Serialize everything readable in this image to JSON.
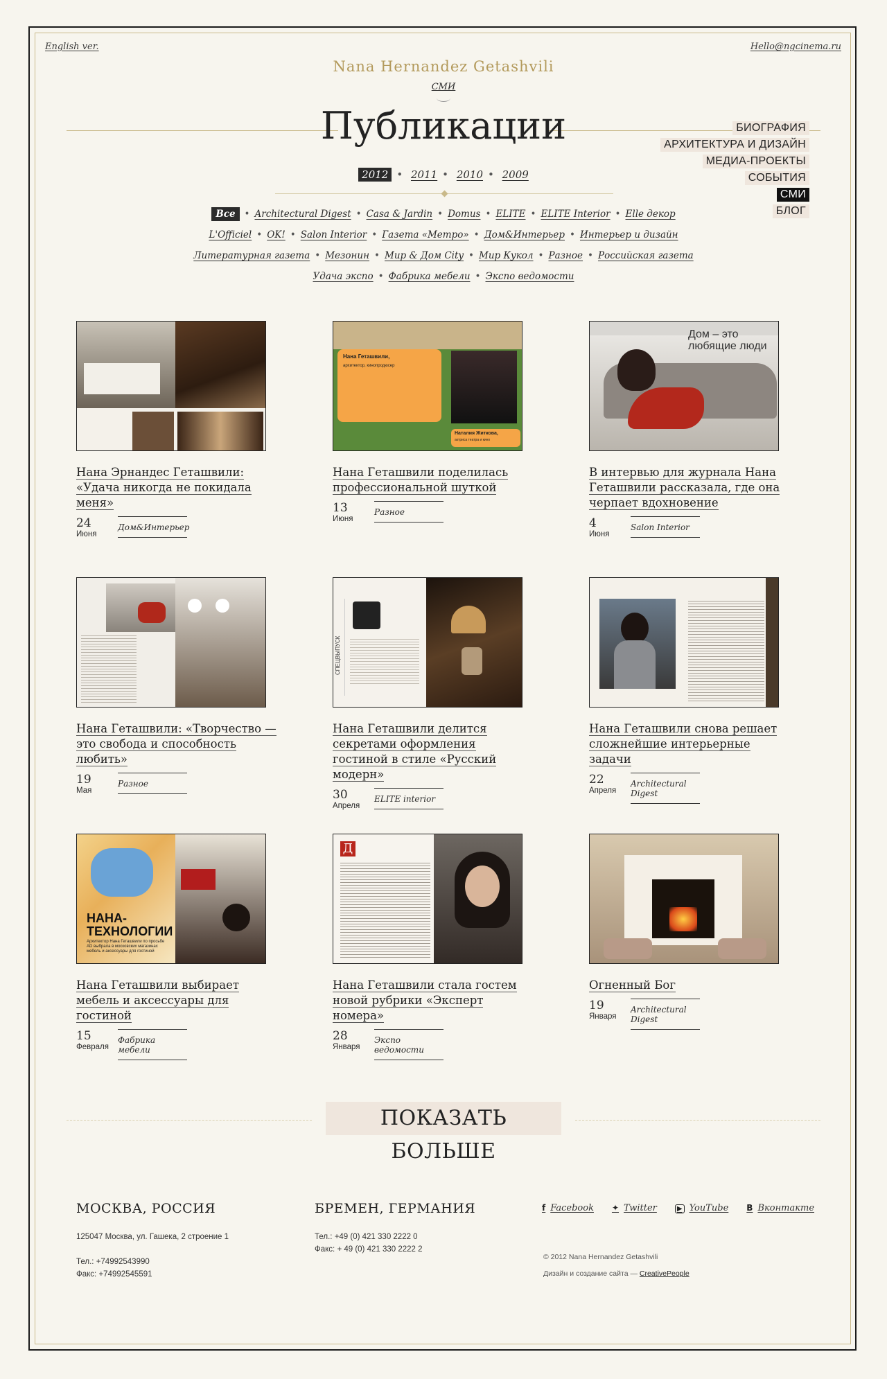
{
  "header": {
    "lang_link": "English ver.",
    "email": "Hello@ngcinema.ru",
    "site_name": "Nana Hernandez Getashvili",
    "section": "СМИ",
    "title": "Публикации"
  },
  "nav": {
    "items": [
      {
        "label": "БИОГРАФИЯ",
        "active": false
      },
      {
        "label": "АРХИТЕКТУРА И ДИЗАЙН",
        "active": false
      },
      {
        "label": "МЕДИА-ПРОЕКТЫ",
        "active": false
      },
      {
        "label": "СОБЫТИЯ",
        "active": false
      },
      {
        "label": "СМИ",
        "active": true
      },
      {
        "label": "БЛОГ",
        "active": false
      }
    ]
  },
  "years": [
    "2012",
    "2011",
    "2010",
    "2009"
  ],
  "years_active": "2012",
  "tags": {
    "row1": [
      "Все",
      "Architectural Digest",
      "Casa & Jardin",
      "Domus",
      "ELITE",
      "ELITE Interior",
      "Elle декор"
    ],
    "row2": [
      "L'Officiel",
      "OK!",
      "Salon Interior",
      "Газета «Метро»",
      "Дом&Интерьер",
      "Интерьер и дизайн"
    ],
    "row3": [
      "Литературная газета",
      "Мезонин",
      "Мир & Дом City",
      "Мир Кукол",
      "Разное",
      "Российская газета"
    ],
    "row4": [
      "Удача экспо",
      "Фабрика мебели",
      "Экспо ведомости"
    ]
  },
  "cards": [
    {
      "title": "Нана Эрнандес Геташвили: «Удача никогда не покидала меня»",
      "day": "24",
      "month": "Июня",
      "source": "Дом&Интерьер"
    },
    {
      "title": "Нана Геташвили поделилась профессиональной шуткой",
      "day": "13",
      "month": "Июня",
      "source": "Разное"
    },
    {
      "title": "В интервью для журнала Нана Геташвили рассказала, где она черпает вдохновение",
      "day": "4",
      "month": "Июня",
      "source": "Salon Interior"
    },
    {
      "title": "Нана Геташвили: «Творчество — это свобода и способность любить»",
      "day": "19",
      "month": "Мая",
      "source": "Разное"
    },
    {
      "title": "Нана Геташвили делится секретами оформления гостиной в стиле «Русский модерн»",
      "day": "30",
      "month": "Апреля",
      "source": "ELITE interior"
    },
    {
      "title": "Нана Геташвили снова решает сложнейшие интерьерные задачи",
      "day": "22",
      "month": "Апреля",
      "source": "Architectural Digest"
    },
    {
      "title": "Нана Геташвили выбирает мебель и аксессуары для гостиной",
      "day": "15",
      "month": "Февраля",
      "source": "Фабрика мебели"
    },
    {
      "title": "Нана Геташвили стала гостем новой рубрики «Эксперт номера»",
      "day": "28",
      "month": "Января",
      "source": "Экспо ведомости"
    },
    {
      "title": "Огненный Бог",
      "day": "19",
      "month": "Января",
      "source": "Architectural Digest"
    }
  ],
  "thumb_texts": {
    "t2_name": "Нана Геташвили,",
    "t2_role": "архитектор, кинопродюсер",
    "t2_person": "Наталия Житкова,",
    "t2_person_role": "актриса театра и кино",
    "t3_headline": "Дом – это любящие люди",
    "t7_headline": "НАНА-ТЕХНОЛОГИИ",
    "t7_sub": "Архитектор Нана Геташвили по просьбе AD выбрала в московских магазинах мебель и аксессуары для гостиной",
    "t5_spine": "СПЕЦВЫПУСК"
  },
  "more_button": "ПОКАЗАТЬ БОЛЬШЕ",
  "footer": {
    "moscow": {
      "city": "МОСКВА, РОССИЯ",
      "address": "125047 Москва, ул. Гашека, 2 строение 1",
      "phone": "Тел.: +74992543990",
      "fax": "Факс: +74992545591"
    },
    "bremen": {
      "city": "БРЕМЕН, ГЕРМАНИЯ",
      "phone": "Тел.: +49 (0) 421 330 2222 0",
      "fax": "Факс: + 49 (0) 421 330 2222 2"
    },
    "social": [
      {
        "icon": "f",
        "label": "Facebook"
      },
      {
        "icon": "🐦",
        "label": "Twitter"
      },
      {
        "icon": "▶",
        "label": "YouTube"
      },
      {
        "icon": "B",
        "label": "Вконтакте"
      }
    ],
    "copyright": "© 2012 Nana Hernandez Getashvili",
    "credit_prefix": "Дизайн и создание сайта —",
    "credit_link": "CreativePeople"
  },
  "colors": {
    "accent_gold": "#b39a5c",
    "page_bg": "#f7f5ee",
    "highlight_bg": "#efe6dd"
  }
}
